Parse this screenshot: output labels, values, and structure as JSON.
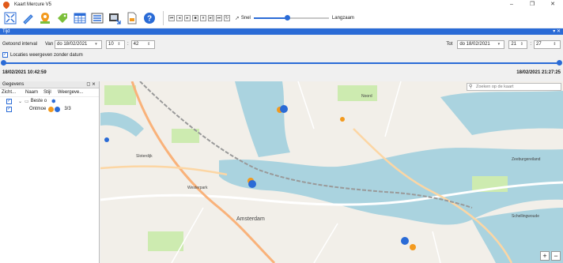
{
  "window": {
    "title": "Kaart Mercure V5",
    "controls": [
      "–",
      "❐",
      "✕"
    ]
  },
  "toolbar": {
    "tools": [
      {
        "name": "zoom-extent-icon"
      },
      {
        "name": "pen-icon"
      },
      {
        "name": "location-pin-icon"
      },
      {
        "name": "tag-icon"
      },
      {
        "name": "table-icon"
      },
      {
        "name": "list-view-icon"
      },
      {
        "name": "export-icon"
      },
      {
        "name": "document-icon"
      },
      {
        "name": "help-icon"
      }
    ],
    "media_glyphs": [
      "⏮",
      "◂",
      "▸",
      "■",
      "⏸",
      "▸|",
      "⏭",
      "↻"
    ],
    "speed_fast": "Snel",
    "speed_slow": "Langzaam",
    "speed_level": 0.45
  },
  "time_panel": {
    "header": "Tijd",
    "interval_label": "Getoond interval",
    "from_label": "Van",
    "from_date": "do 18/02/2021",
    "from_hour": "10",
    "from_minute": "42",
    "to_label": "Tot",
    "to_date": "do 18/02/2021",
    "to_hour": "21",
    "to_minute": "27",
    "show_undated_label": "Locaties weergeven zonder datum",
    "show_undated_checked": true,
    "range_start": "18/02/2021 10:42:59",
    "range_end": "18/02/2021 21:27:25"
  },
  "data_panel": {
    "header": "Gegevens",
    "columns": [
      "Zicht...",
      "Naam",
      "Stijl",
      "Weergeve..."
    ],
    "rows": [
      {
        "name": "Beste o",
        "display": ""
      },
      {
        "name": "Ontmoe",
        "display": "3/3"
      }
    ]
  },
  "map": {
    "search_placeholder": "Zoeken op de kaart",
    "labels": [
      "Amsterdam",
      "Zeeburgereiland",
      "Schellingwoude",
      "Sloterdijk",
      "Westerpark",
      "Noord"
    ]
  },
  "colors": {
    "accent": "#2a6bd6",
    "orange": "#f39a1e",
    "water": "#aad3df"
  }
}
